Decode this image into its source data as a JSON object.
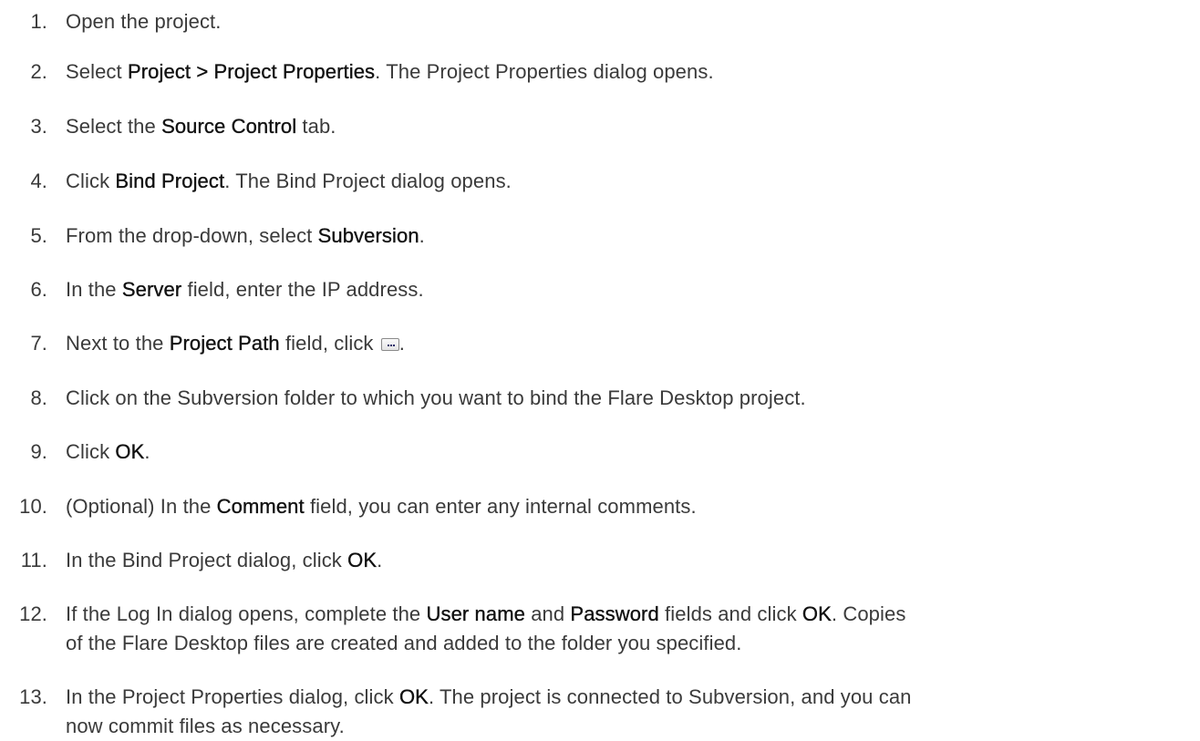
{
  "steps": [
    {
      "num": "1.",
      "parts": [
        {
          "t": "Open the project."
        }
      ]
    },
    {
      "num": "2.",
      "parts": [
        {
          "t": "Select "
        },
        {
          "t": "Project > Project Properties",
          "b": true
        },
        {
          "t": ". The Project Properties dialog opens."
        }
      ]
    },
    {
      "num": "3.",
      "parts": [
        {
          "t": "Select the "
        },
        {
          "t": "Source Control",
          "b": true
        },
        {
          "t": " tab."
        }
      ]
    },
    {
      "num": "4.",
      "parts": [
        {
          "t": "Click "
        },
        {
          "t": "Bind Project",
          "b": true
        },
        {
          "t": ". The Bind Project dialog opens."
        }
      ]
    },
    {
      "num": "5.",
      "parts": [
        {
          "t": "From the drop-down, select "
        },
        {
          "t": "Subversion",
          "b": true
        },
        {
          "t": "."
        }
      ]
    },
    {
      "num": "6.",
      "parts": [
        {
          "t": "In the "
        },
        {
          "t": "Server",
          "b": true
        },
        {
          "t": " field, enter the IP address."
        }
      ]
    },
    {
      "num": "7.",
      "parts": [
        {
          "t": "Next to the "
        },
        {
          "t": "Project Path",
          "b": true
        },
        {
          "t": " field, click "
        },
        {
          "icon": "browse-ellipsis-icon"
        },
        {
          "t": "."
        }
      ]
    },
    {
      "num": "8.",
      "parts": [
        {
          "t": "Click on the Subversion folder to which you want to bind the Flare Desktop project."
        }
      ]
    },
    {
      "num": "9.",
      "parts": [
        {
          "t": "Click "
        },
        {
          "t": "OK",
          "b": true
        },
        {
          "t": "."
        }
      ]
    },
    {
      "num": "10.",
      "parts": [
        {
          "t": "(Optional) In the "
        },
        {
          "t": "Comment",
          "b": true
        },
        {
          "t": " field, you can enter any internal comments."
        }
      ]
    },
    {
      "num": "11.",
      "parts": [
        {
          "t": "In the Bind Project dialog, click "
        },
        {
          "t": "OK",
          "b": true
        },
        {
          "t": "."
        }
      ]
    },
    {
      "num": "12.",
      "lines": [
        [
          {
            "t": "If the Log In dialog opens, complete the "
          },
          {
            "t": "User name",
            "b": true
          },
          {
            "t": " and "
          },
          {
            "t": "Password",
            "b": true
          },
          {
            "t": " fields and click "
          },
          {
            "t": "OK",
            "b": true
          },
          {
            "t": ". Copies"
          }
        ],
        [
          {
            "t": "of the Flare Desktop files are created and added to the folder you specified."
          }
        ]
      ]
    },
    {
      "num": "13.",
      "lines": [
        [
          {
            "t": "In the Project Properties dialog, click "
          },
          {
            "t": "OK",
            "b": true
          },
          {
            "t": ". The project is connected to Subversion, and you can"
          }
        ],
        [
          {
            "t": "now commit files as necessary."
          }
        ]
      ]
    }
  ]
}
